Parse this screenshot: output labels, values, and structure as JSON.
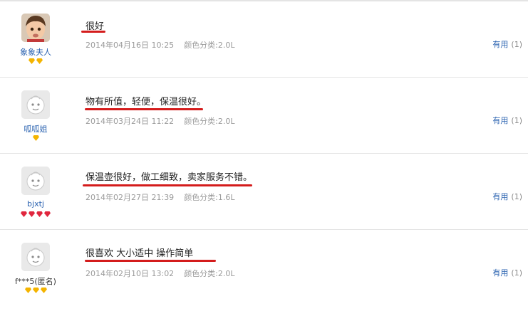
{
  "reviews": [
    {
      "username": "象象夫人",
      "avatar": "baby-photo",
      "badge_count": 2,
      "badge_color": "#f4b400",
      "content": "很好",
      "date": "2014年04月16日 10:25",
      "spec": "颜色分类:2.0L",
      "useful_label": "有用",
      "useful_count": "(1)"
    },
    {
      "username": "呱呱姐",
      "avatar": "default-face",
      "badge_count": 1,
      "badge_color": "#f4b400",
      "content": "物有所值，轻便，保温很好。",
      "date": "2014年03月24日 11:22",
      "spec": "颜色分类:2.0L",
      "useful_label": "有用",
      "useful_count": "(1)"
    },
    {
      "username": "bjxtj",
      "avatar": "default-face",
      "badge_count": 4,
      "badge_color": "#e0263e",
      "content": "保温壶很好，做工细致，卖家服务不错。",
      "date": "2014年02月27日 21:39",
      "spec": "颜色分类:1.6L",
      "useful_label": "有用",
      "useful_count": "(1)"
    },
    {
      "username": "f***5(匿名)",
      "avatar": "default-face",
      "badge_count": 3,
      "badge_color": "#f4b400",
      "content": "很喜欢 大小适中 操作简单",
      "date": "2014年02月10日 13:02",
      "spec": "颜色分类:2.0L",
      "useful_label": "有用",
      "useful_count": "(1)"
    }
  ]
}
